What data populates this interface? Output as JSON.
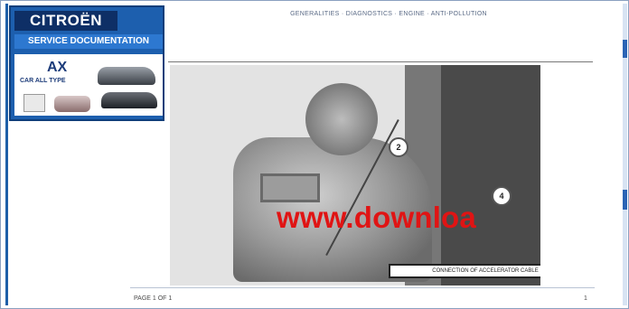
{
  "logo": {
    "brand": "CITROËN",
    "subtitle": "SERVICE DOCUMENTATION",
    "model": "AX",
    "model_sub": "CAR ALL TYPE"
  },
  "topnav": {
    "text": "GENERALITIES · DIAGNOSTICS · ENGINE · ANTI-POLLUTION"
  },
  "figure": {
    "callout_1": "2",
    "callout_2": "4",
    "caption": "CONNECTION OF ACCELERATOR CABLE"
  },
  "watermark": {
    "text": "www.downloa"
  },
  "status": {
    "left": "PAGE 1 OF 1",
    "right": "1"
  }
}
